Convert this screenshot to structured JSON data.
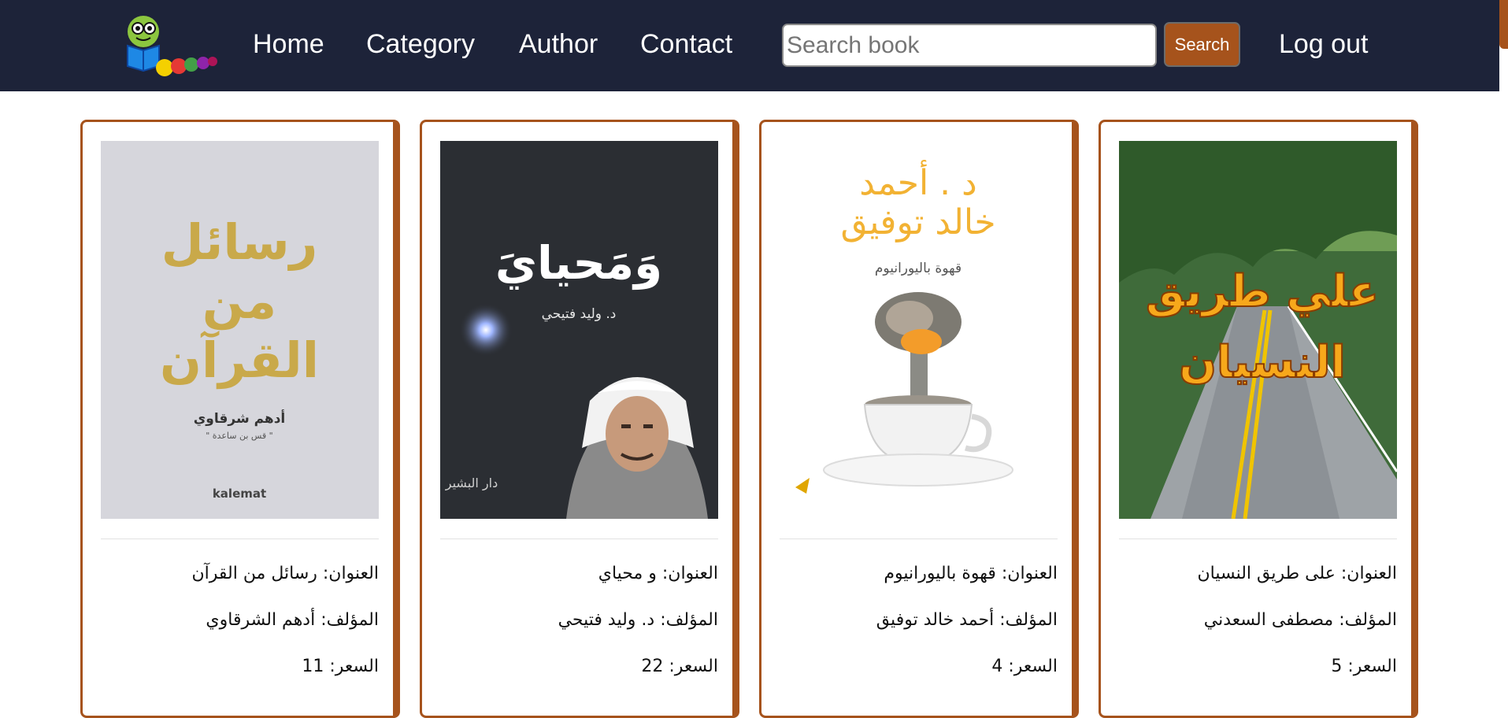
{
  "nav": {
    "links": [
      "Home",
      "Category",
      "Author",
      "Contact"
    ],
    "search_placeholder": "Search book",
    "search_button": "Search",
    "logout": "Log out"
  },
  "books": [
    {
      "cover_title_lines": [
        "رسائل",
        "من",
        "القرآن"
      ],
      "cover_author": "أدهم شرقاوي",
      "cover_subtitle": "\" قس بن ساعدة \"",
      "cover_publisher": "kalemat",
      "title": "العنوان: رسائل من القرآن",
      "author": "المؤلف: أدهم الشرقاوي",
      "price": "السعر: 11"
    },
    {
      "cover_title_lines": [
        "وَمَحيايَ"
      ],
      "cover_author": "د. وليد فتيحي",
      "cover_publisher": "دار البشير",
      "title": "العنوان: و محياي",
      "author": "المؤلف: د. وليد فتيحي",
      "price": "السعر: 22"
    },
    {
      "cover_title_lines": [
        "د . أحمد",
        "خالد توفيق"
      ],
      "cover_subtitle": "قهوة باليورانيوم",
      "title": "العنوان: قهوة باليورانيوم",
      "author": "المؤلف: أحمد خالد توفيق",
      "price": "السعر: 4"
    },
    {
      "cover_title_lines": [
        "علي طريق",
        "النسيان"
      ],
      "title": "العنوان: على طريق النسيان",
      "author": "المؤلف: مصطفى السعدني",
      "price": "السعر: 5"
    }
  ],
  "colors": {
    "navbar": "#1d2339",
    "accent": "#a6531c",
    "gold": "#f2b233"
  },
  "icons": {
    "logo": "bookworm-logo"
  }
}
